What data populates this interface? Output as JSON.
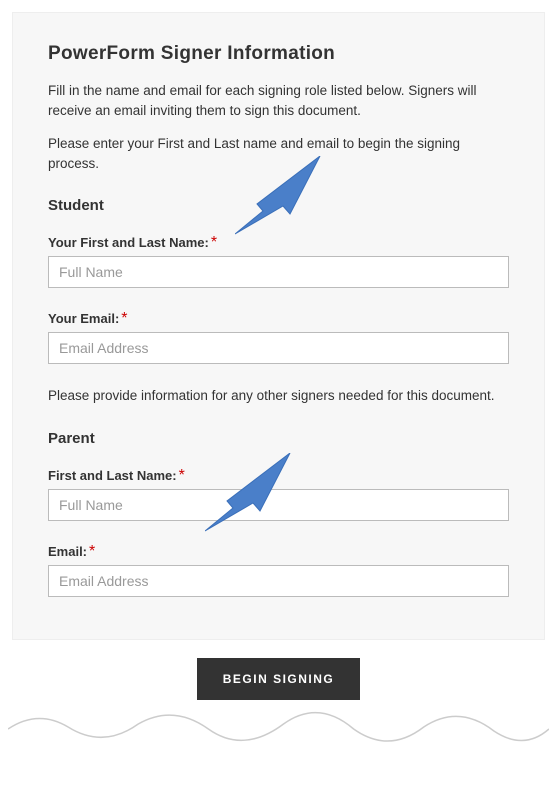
{
  "title": "PowerForm Signer Information",
  "intro1": "Fill in the name and email for each signing role listed below. Signers will receive an email inviting them to sign this document.",
  "intro2": "Please enter your First and Last name and email to begin the signing process.",
  "student": {
    "heading": "Student",
    "name_label": "Your First and Last Name:",
    "name_placeholder": "Full Name",
    "email_label": "Your Email:",
    "email_placeholder": "Email Address"
  },
  "mid_text": "Please provide information for any other signers needed for this document.",
  "parent": {
    "heading": "Parent",
    "name_label": "First and Last Name:",
    "name_placeholder": "Full Name",
    "email_label": "Email:",
    "email_placeholder": "Email Address"
  },
  "required_mark": "*",
  "button": "BEGIN SIGNING",
  "arrow_color": "#4a7fc9"
}
